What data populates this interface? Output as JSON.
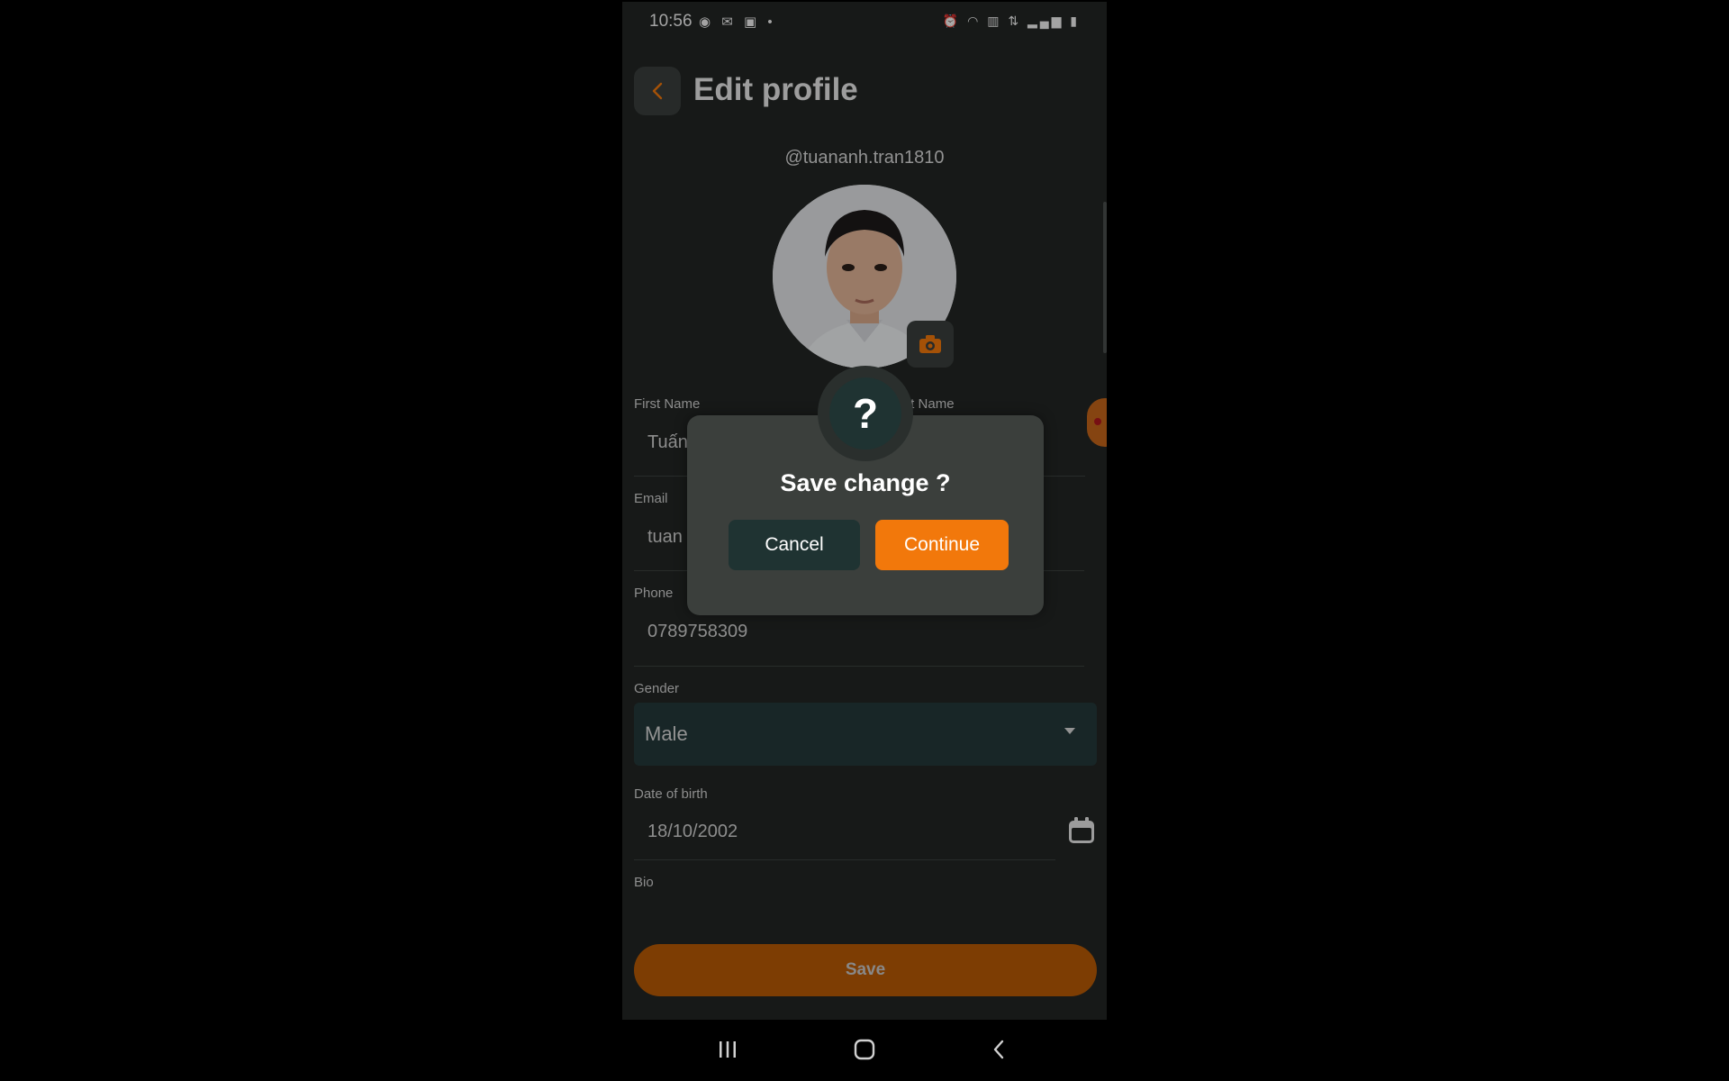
{
  "status_bar": {
    "time": "10:56",
    "left_icons": [
      "globe-icon",
      "mail-icon",
      "gallery-icon",
      "dot"
    ],
    "right_icons": [
      "alarm-icon",
      "hotspot-icon",
      "volte-icon",
      "4g-icon",
      "signal-icon",
      "battery-icon"
    ]
  },
  "header": {
    "title": "Edit profile"
  },
  "profile": {
    "username": "@tuananh.tran1810"
  },
  "form": {
    "first_name": {
      "label": "First Name",
      "value": "Tuấn"
    },
    "last_name": {
      "label": "Last Name"
    },
    "email": {
      "label": "Email",
      "value": "tuan"
    },
    "phone": {
      "label": "Phone",
      "value": "0789758309"
    },
    "gender": {
      "label": "Gender",
      "value": "Male"
    },
    "dob": {
      "label": "Date of birth",
      "value": "18/10/2002"
    },
    "bio": {
      "label": "Bio"
    }
  },
  "save_button": {
    "label": "Save"
  },
  "dialog": {
    "icon": "?",
    "title": "Save change ?",
    "cancel_label": "Cancel",
    "continue_label": "Continue"
  },
  "colors": {
    "accent": "#f2780b",
    "accent_dim": "#b85a05",
    "background": "#222624",
    "teal_dark": "#1f3332"
  },
  "nav_bar": {
    "icons": [
      "recent-apps-icon",
      "home-icon",
      "back-icon"
    ]
  }
}
